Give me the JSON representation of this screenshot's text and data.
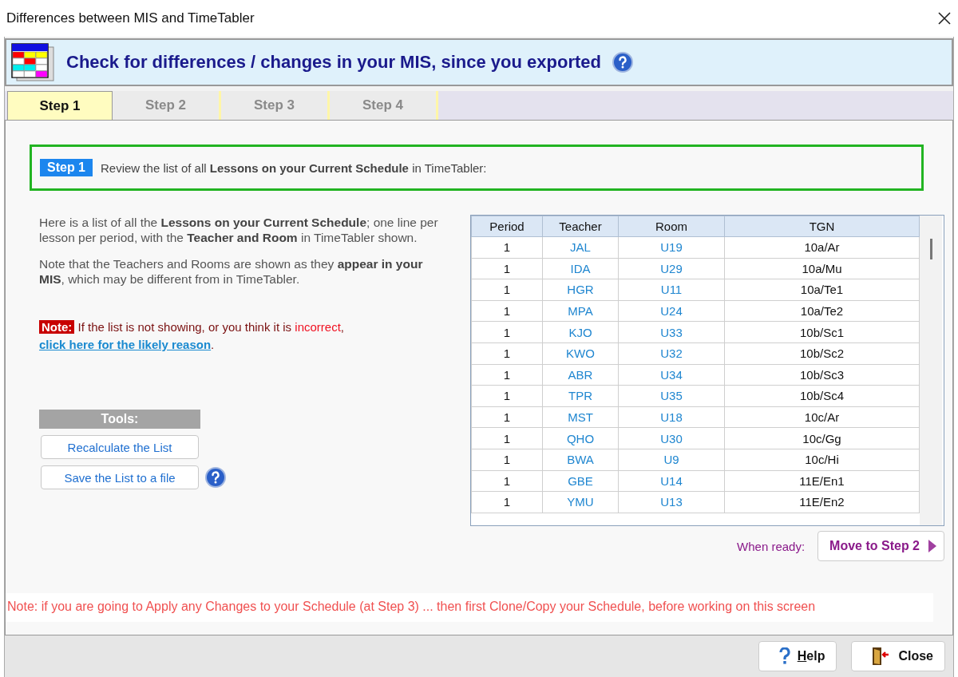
{
  "window": {
    "title": "Differences between MIS and TimeTabler"
  },
  "header": {
    "title": "Check for differences / changes in your MIS, since you exported"
  },
  "tabs": [
    {
      "label": "Step 1",
      "selected": true
    },
    {
      "label": "Step 2",
      "selected": false
    },
    {
      "label": "Step 3",
      "selected": false
    },
    {
      "label": "Step 4",
      "selected": false
    }
  ],
  "step_banner": {
    "badge": "Step 1",
    "text": "Review the list of all **Lessons on your Current Schedule** in TimeTabler:"
  },
  "paragraphs": [
    "Here is a list of all the **Lessons on your Current Schedule**; one line per lesson per period, with the **Teacher and Room** in TimeTabler shown.",
    "Note that the Teachers and Rooms are shown as they **appear in your MIS**, which may be different from in TimeTabler."
  ],
  "note": {
    "label": "Note:",
    "text": "If the list is not showing, or you think it is",
    "highlight": "incorrect",
    "after": ",",
    "link": "click here for the likely reason",
    "end": "."
  },
  "tools": {
    "title": "Tools:",
    "buttons": [
      "Recalculate the List",
      "Save the List to a file"
    ]
  },
  "table": {
    "columns": [
      "Period",
      "Teacher",
      "Room",
      "TGN"
    ],
    "rows": [
      [
        "1",
        "JAL",
        "U19",
        "10a/Ar"
      ],
      [
        "1",
        "IDA",
        "U29",
        "10a/Mu"
      ],
      [
        "1",
        "HGR",
        "U11",
        "10a/Te1"
      ],
      [
        "1",
        "MPA",
        "U24",
        "10a/Te2"
      ],
      [
        "1",
        "KJO",
        "U33",
        "10b/Sc1"
      ],
      [
        "1",
        "KWO",
        "U32",
        "10b/Sc2"
      ],
      [
        "1",
        "ABR",
        "U34",
        "10b/Sc3"
      ],
      [
        "1",
        "TPR",
        "U35",
        "10b/Sc4"
      ],
      [
        "1",
        "MST",
        "U18",
        "10c/Ar"
      ],
      [
        "1",
        "QHO",
        "U30",
        "10c/Gg"
      ],
      [
        "1",
        "BWA",
        "U9",
        "10c/Hi"
      ],
      [
        "1",
        "GBE",
        "U14",
        "11E/En1"
      ],
      [
        "1",
        "YMU",
        "U13",
        "11E/En2"
      ]
    ]
  },
  "next": {
    "label": "When ready:",
    "button": "Move to Step 2"
  },
  "warning": "Note: if you are going to Apply any Changes to your Schedule (at Step 3) ... then first Clone/Copy your Schedule, before working on this screen",
  "footer": {
    "buttons": [
      {
        "kind": "help",
        "label": "Help"
      },
      {
        "kind": "close",
        "label": "Close"
      }
    ]
  }
}
